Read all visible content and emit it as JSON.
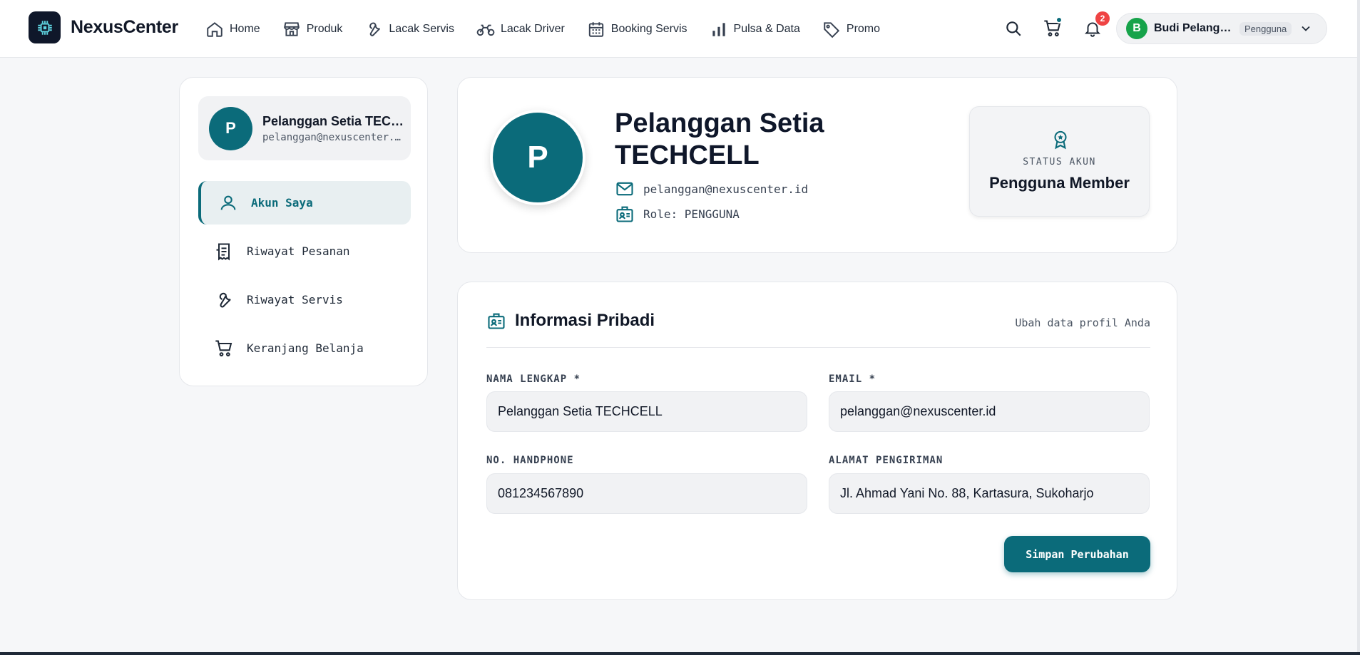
{
  "brand": {
    "name": "NexusCenter",
    "logo_icon": "cpu-chip-icon"
  },
  "nav": [
    {
      "label": "Home",
      "icon": "home-icon"
    },
    {
      "label": "Produk",
      "icon": "store-icon"
    },
    {
      "label": "Lacak Servis",
      "icon": "wrench-icon"
    },
    {
      "label": "Lacak Driver",
      "icon": "motorcycle-icon"
    },
    {
      "label": "Booking Servis",
      "icon": "calendar-icon"
    },
    {
      "label": "Pulsa & Data",
      "icon": "signal-bars-icon"
    },
    {
      "label": "Promo",
      "icon": "tag-icon"
    }
  ],
  "topbar": {
    "notification_count": "2",
    "user": {
      "initial": "B",
      "name": "Budi Pelanggan",
      "role": "Pengguna"
    }
  },
  "sidebar": {
    "profile": {
      "initial": "P",
      "name": "Pelanggan Setia TECHCELL",
      "email": "pelanggan@nexuscenter.id"
    },
    "items": [
      {
        "label": "Akun Saya",
        "icon": "user-icon",
        "active": true
      },
      {
        "label": "Riwayat Pesanan",
        "icon": "receipt-icon",
        "active": false
      },
      {
        "label": "Riwayat Servis",
        "icon": "wrench-icon",
        "active": false
      },
      {
        "label": "Keranjang Belanja",
        "icon": "cart-icon",
        "active": false
      }
    ]
  },
  "profile": {
    "initial": "P",
    "name": "Pelanggan Setia TECHCELL",
    "email": "pelanggan@nexuscenter.id",
    "role": "Role: PENGGUNA",
    "status_label": "STATUS AKUN",
    "status_value": "Pengguna Member"
  },
  "form": {
    "title": "Informasi Pribadi",
    "hint": "Ubah data profil Anda",
    "fields": {
      "name": {
        "label": "NAMA LENGKAP *",
        "value": "Pelanggan Setia TECHCELL"
      },
      "email": {
        "label": "EMAIL *",
        "value": "pelanggan@nexuscenter.id"
      },
      "phone": {
        "label": "NO. HANDPHONE",
        "value": "081234567890"
      },
      "address": {
        "label": "ALAMAT PENGIRIMAN",
        "value": "Jl. Ahmad Yani No. 88, Kartasura, Sukoharjo"
      }
    },
    "save_label": "Simpan Perubahan"
  },
  "colors": {
    "accent": "#0b6b7a",
    "badge": "#ef4444",
    "user_avatar": "#16a34a"
  }
}
